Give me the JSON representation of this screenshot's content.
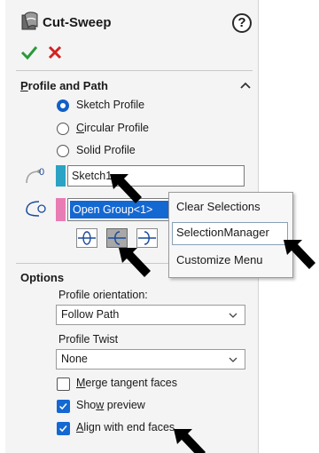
{
  "header": {
    "title": "Cut-Sweep",
    "help_glyph": "?"
  },
  "actions": {
    "ok_icon": "check-icon",
    "cancel_icon": "close-icon"
  },
  "profile_and_path": {
    "title": "Profile and Path",
    "options": [
      {
        "label_pre": "",
        "label_ul": "",
        "label": "Sketch Profile",
        "selected": true
      },
      {
        "label_ul": "C",
        "label_rest": "ircular Profile",
        "selected": false
      },
      {
        "label_ul": "",
        "label": "Solid Profile",
        "selected": false
      }
    ],
    "profile_field": {
      "value": "Sketch1",
      "swatch_color": "#2aa3c4"
    },
    "path_field": {
      "value": "Open Group<1>",
      "swatch_color": "#e87cb4"
    }
  },
  "context_menu": {
    "items": [
      "Clear Selections",
      "SelectionManager",
      "Customize Menu"
    ],
    "highlighted_index": 1
  },
  "options": {
    "title": "Options",
    "profile_orientation_label": "Profile orientation:",
    "profile_orientation_value": "Follow Path",
    "profile_twist_label": "Profile Twist",
    "profile_twist_value": "None",
    "merge": {
      "label_ul": "M",
      "label_rest": "erge tangent faces",
      "checked": false
    },
    "preview": {
      "label_pre": "Sho",
      "label_ul": "w",
      "label_rest": " preview",
      "checked": true
    },
    "align": {
      "label_ul": "A",
      "label_rest": "lign with end faces",
      "checked": true
    }
  },
  "colors": {
    "accent": "#1468d2",
    "ok_green": "#2a9a3a",
    "cancel_red": "#d42020"
  }
}
